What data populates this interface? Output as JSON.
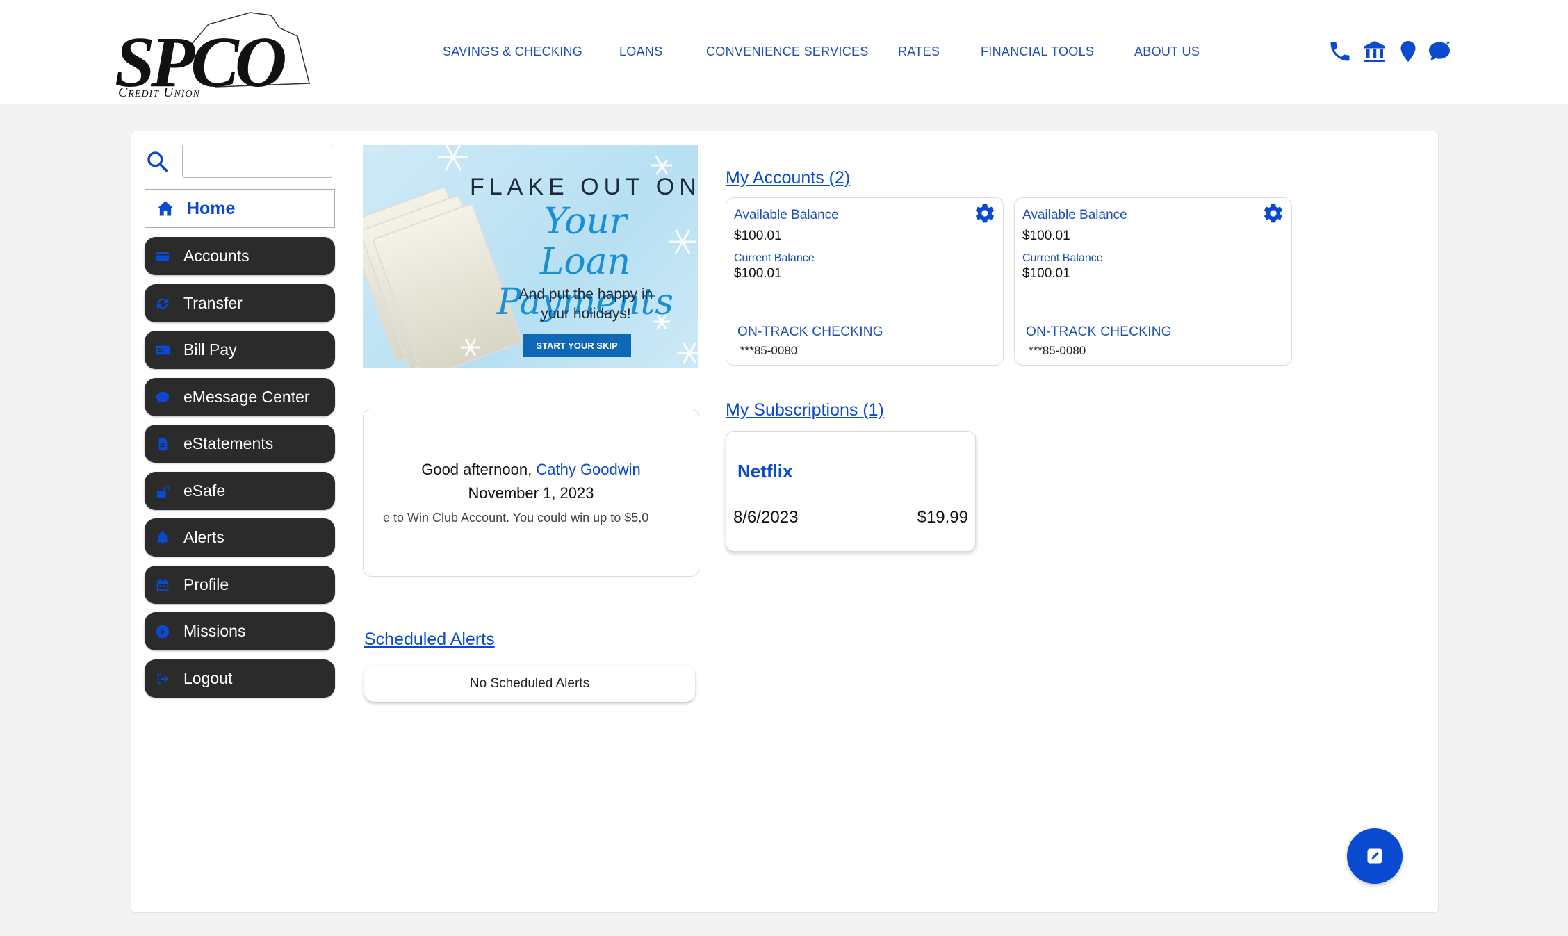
{
  "brand": {
    "name": "SPCO",
    "sub": "Credit Union"
  },
  "nav": [
    {
      "label": "SAVINGS & CHECKING"
    },
    {
      "label": "LOANS"
    },
    {
      "label": "CONVENIENCE SERVICES"
    },
    {
      "label": "RATES"
    },
    {
      "label": "FINANCIAL TOOLS"
    },
    {
      "label": "ABOUT US"
    }
  ],
  "header_icons": [
    "phone-icon",
    "bank-icon",
    "location-pin-icon",
    "chat-icon"
  ],
  "search": {
    "placeholder": ""
  },
  "sidebar": {
    "home": "Home",
    "items": [
      {
        "label": "Accounts",
        "icon": "credit-card-icon"
      },
      {
        "label": "Transfer",
        "icon": "refresh-icon"
      },
      {
        "label": "Bill Pay",
        "icon": "bill-icon"
      },
      {
        "label": "eMessage Center",
        "icon": "message-icon"
      },
      {
        "label": "eStatements",
        "icon": "document-icon"
      },
      {
        "label": "eSafe",
        "icon": "unlock-icon"
      },
      {
        "label": "Alerts",
        "icon": "bell-icon"
      },
      {
        "label": "Profile",
        "icon": "calendar-icon"
      },
      {
        "label": "Missions",
        "icon": "play-circle-icon"
      },
      {
        "label": "Logout",
        "icon": "logout-icon"
      }
    ]
  },
  "banner": {
    "headline": "FLAKE OUT ON",
    "script_line1": "Your Loan",
    "script_line2": "Payments",
    "subtext_line1": "And put the happy in",
    "subtext_line2": "your holidays!",
    "cta": "START YOUR SKIP"
  },
  "greeting": {
    "prefix": "Good afternoon,",
    "name": "Cathy Goodwin",
    "date": "November 1, 2023",
    "marquee": "e to Win Club Account. You could win up to $5,0"
  },
  "scheduled_alerts": {
    "title": "Scheduled Alerts",
    "empty": "No Scheduled Alerts"
  },
  "accounts": {
    "title": "My Accounts (2)",
    "list": [
      {
        "available_label": "Available Balance",
        "available": "$100.01",
        "current_label": "Current Balance",
        "current": "$100.01",
        "name": "ON-TRACK CHECKING",
        "number": "***85-0080"
      },
      {
        "available_label": "Available Balance",
        "available": "$100.01",
        "current_label": "Current Balance",
        "current": "$100.01",
        "name": "ON-TRACK CHECKING",
        "number": "***85-0080"
      }
    ]
  },
  "subscriptions": {
    "title": "My Subscriptions (1)",
    "list": [
      {
        "service": "Netflix",
        "date": "8/6/2023",
        "amount": "$19.99"
      }
    ]
  },
  "colors": {
    "accent": "#0a4ad0",
    "sidebar_button": "#2b2b2b",
    "panel_bg": "#ffffff",
    "page_bg": "#f3f3f3"
  }
}
